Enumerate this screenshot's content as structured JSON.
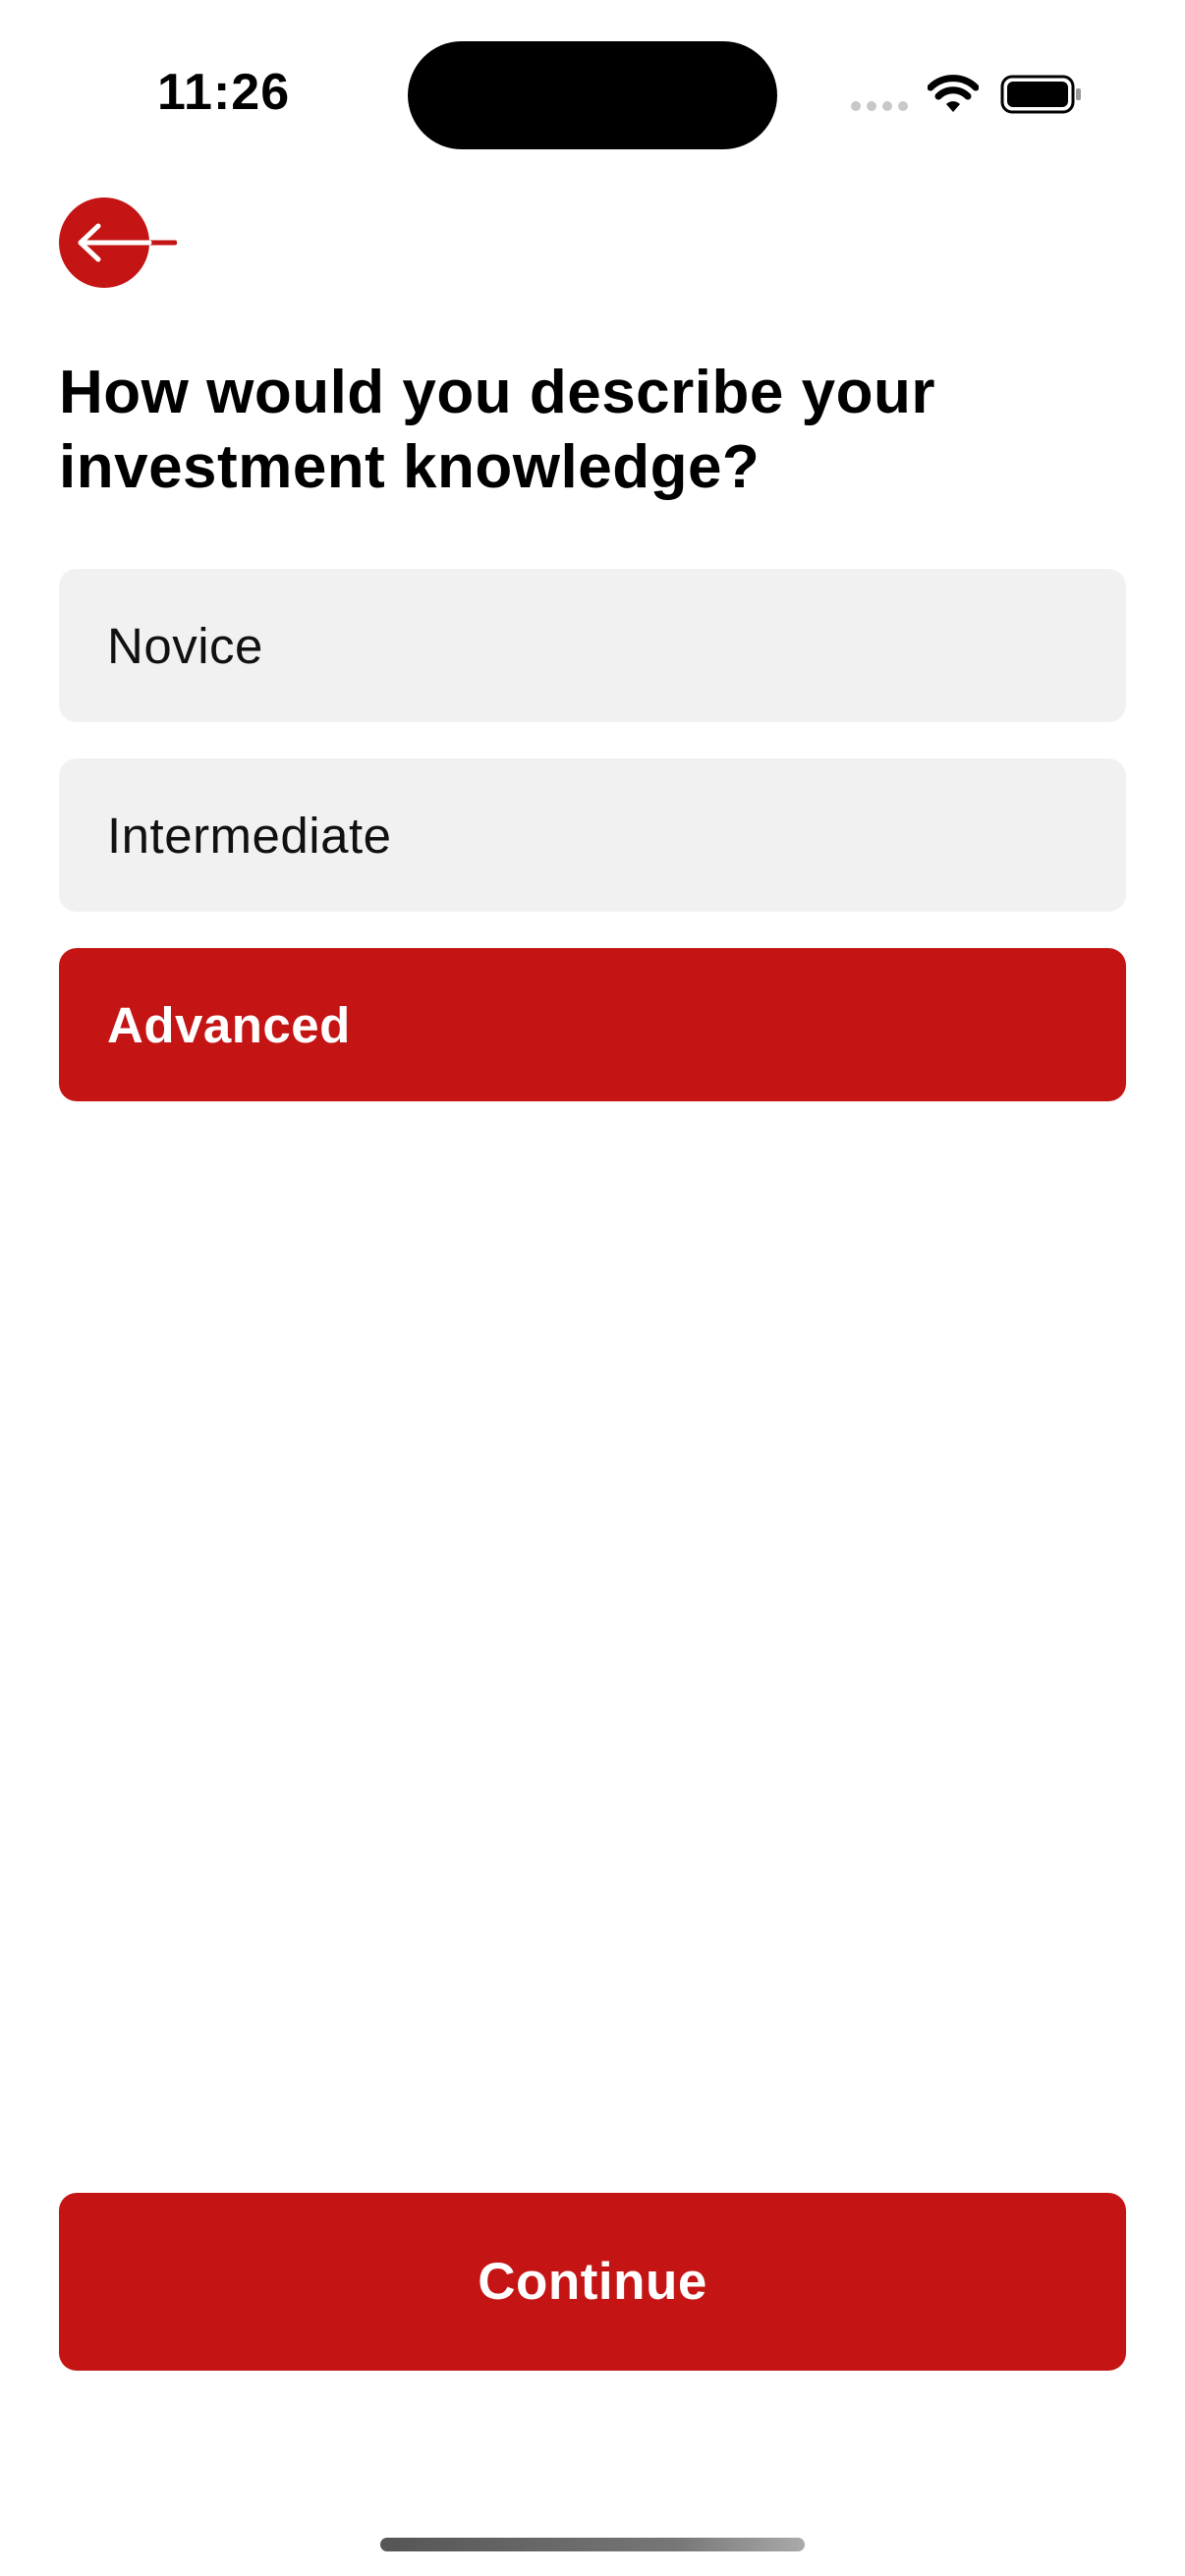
{
  "status_bar": {
    "time": "11:26",
    "icons": [
      "cellular-dots-icon",
      "wifi-icon",
      "battery-icon"
    ]
  },
  "header": {
    "back_icon": "arrow-left-icon"
  },
  "question": {
    "title": "How would you describe your investment knowledge?"
  },
  "options": [
    {
      "label": "Novice",
      "selected": false
    },
    {
      "label": "Intermediate",
      "selected": false
    },
    {
      "label": "Advanced",
      "selected": true
    }
  ],
  "footer": {
    "continue_label": "Continue"
  },
  "colors": {
    "accent": "#c41414",
    "option_bg": "#f1f1f1",
    "background": "#ffffff"
  }
}
